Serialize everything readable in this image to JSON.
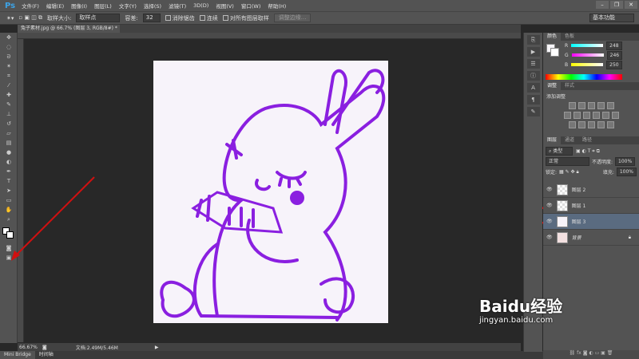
{
  "app": {
    "logo": "Ps"
  },
  "menu": [
    "文件(F)",
    "编辑(E)",
    "图像(I)",
    "图层(L)",
    "文字(Y)",
    "选择(S)",
    "滤镜(T)",
    "3D(D)",
    "视图(V)",
    "窗口(W)",
    "帮助(H)"
  ],
  "window_controls": [
    "–",
    "❐",
    "✕"
  ],
  "options": {
    "sample_size_label": "取样大小:",
    "sample_size_value": "取样点",
    "tolerance_label": "容差:",
    "tolerance_value": "32",
    "anti_alias": "消除锯齿",
    "contiguous": "连续",
    "sample_all": "对所有图层取样",
    "refine_edge": "调整边缘...",
    "workspace": "基本功能"
  },
  "document": {
    "tab": "兔子素材.jpg @ 66.7% (图层 3, RGB/8#) *",
    "zoom": "66.67%",
    "doc_info": "文档:2.49M/5.46M"
  },
  "bottom_tabs": [
    "Mini Bridge",
    "时间轴"
  ],
  "color_panel": {
    "tabs": [
      "颜色",
      "色板"
    ],
    "r": "248",
    "g": "246",
    "b": "250"
  },
  "adjust_panel": {
    "tabs": [
      "调整",
      "样式"
    ],
    "title": "添加调整"
  },
  "layers_panel": {
    "tabs": [
      "图层",
      "通道",
      "路径"
    ],
    "filter": "类型",
    "blend": "正常",
    "opacity_label": "不透明度:",
    "opacity": "100%",
    "lock_label": "锁定:",
    "fill_label": "填充:",
    "fill": "100%",
    "layers": [
      {
        "name": "图层 2"
      },
      {
        "name": "图层 1"
      },
      {
        "name": "图层 3",
        "selected": true
      },
      {
        "name": "背景",
        "locked": true
      }
    ]
  },
  "watermark": "Baidu经验 jingyan.baidu.com",
  "colors": {
    "stroke": "#8a1fe0",
    "annotation": "#d01010"
  }
}
